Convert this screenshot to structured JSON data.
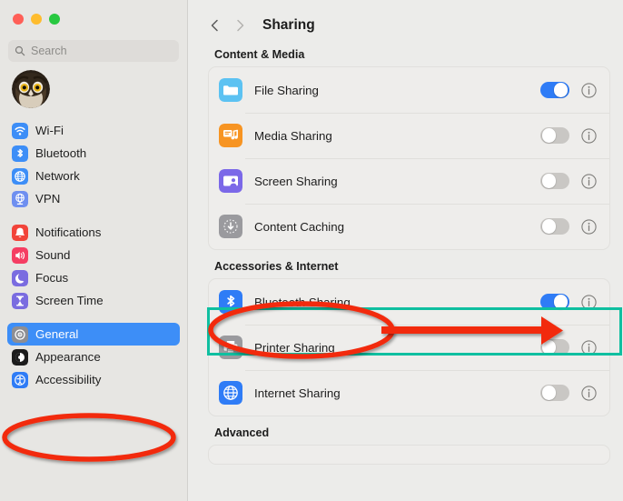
{
  "window": {
    "traffic_lights": [
      {
        "name": "close",
        "color": "#ff5f57"
      },
      {
        "name": "minimize",
        "color": "#febc2e"
      },
      {
        "name": "zoom",
        "color": "#28c840"
      }
    ]
  },
  "sidebar": {
    "search": {
      "placeholder": "Search",
      "value": ""
    },
    "account": {
      "name": "user-avatar",
      "image": "owl-photo"
    },
    "groups": [
      {
        "items": [
          {
            "label": "Wi-Fi",
            "icon": "wifi-icon",
            "color": "#3d8ef7",
            "selected": false
          },
          {
            "label": "Bluetooth",
            "icon": "bluetooth-icon",
            "color": "#3d8ef7",
            "selected": false
          },
          {
            "label": "Network",
            "icon": "network-globe-icon",
            "color": "#3d8ef7",
            "selected": false
          },
          {
            "label": "VPN",
            "icon": "vpn-globe-icon",
            "color": "#6f8ff0",
            "selected": false
          }
        ]
      },
      {
        "items": [
          {
            "label": "Notifications",
            "icon": "bell-icon",
            "color": "#f2443a",
            "selected": false
          },
          {
            "label": "Sound",
            "icon": "speaker-icon",
            "color": "#f53e63",
            "selected": false
          },
          {
            "label": "Focus",
            "icon": "moon-icon",
            "color": "#7a6ce0",
            "selected": false
          },
          {
            "label": "Screen Time",
            "icon": "hourglass-icon",
            "color": "#7a6ce0",
            "selected": false
          }
        ]
      },
      {
        "items": [
          {
            "label": "General",
            "icon": "gear-icon",
            "color": "#8e8e93",
            "selected": true
          },
          {
            "label": "Appearance",
            "icon": "appearance-icon",
            "color": "#1c1c1c",
            "selected": false
          },
          {
            "label": "Accessibility",
            "icon": "accessibility-icon",
            "color": "#2f7cf6",
            "selected": false
          }
        ]
      }
    ]
  },
  "header": {
    "back_icon": "chevron-left-icon",
    "forward_icon": "chevron-right-icon",
    "title": "Sharing"
  },
  "sections": [
    {
      "title": "Content & Media",
      "rows": [
        {
          "label": "File Sharing",
          "icon": "folder-icon",
          "icon_color": "#5cc2f2",
          "enabled": true,
          "info_icon": "info-icon"
        },
        {
          "label": "Media Sharing",
          "icon": "media-note-icon",
          "icon_color": "#f79422",
          "enabled": false,
          "info_icon": "info-icon"
        },
        {
          "label": "Screen Sharing",
          "icon": "screen-person-icon",
          "icon_color": "#7b68e8",
          "enabled": false,
          "info_icon": "info-icon"
        },
        {
          "label": "Content Caching",
          "icon": "download-arrow-icon",
          "icon_color": "#9a9a9e",
          "enabled": false,
          "info_icon": "info-icon"
        }
      ]
    },
    {
      "title": "Accessories & Internet",
      "rows": [
        {
          "label": "Bluetooth Sharing",
          "icon": "bluetooth-icon",
          "icon_color": "#2f7cf6",
          "enabled": true,
          "info_icon": "info-icon",
          "highlighted": true
        },
        {
          "label": "Printer Sharing",
          "icon": "printer-icon",
          "icon_color": "#9a9a9e",
          "enabled": false,
          "info_icon": "info-icon"
        },
        {
          "label": "Internet Sharing",
          "icon": "globe-icon",
          "icon_color": "#2f7cf6",
          "enabled": false,
          "info_icon": "info-icon"
        }
      ]
    },
    {
      "title": "Advanced",
      "rows": []
    }
  ],
  "annotations": {
    "ellipse_color": "#f22c10",
    "box_color": "#0fbfa0",
    "arrow_color": "#f22c10",
    "targets": [
      "general-sidebar-item",
      "bluetooth-sharing-row",
      "bluetooth-sharing-toggle"
    ]
  }
}
